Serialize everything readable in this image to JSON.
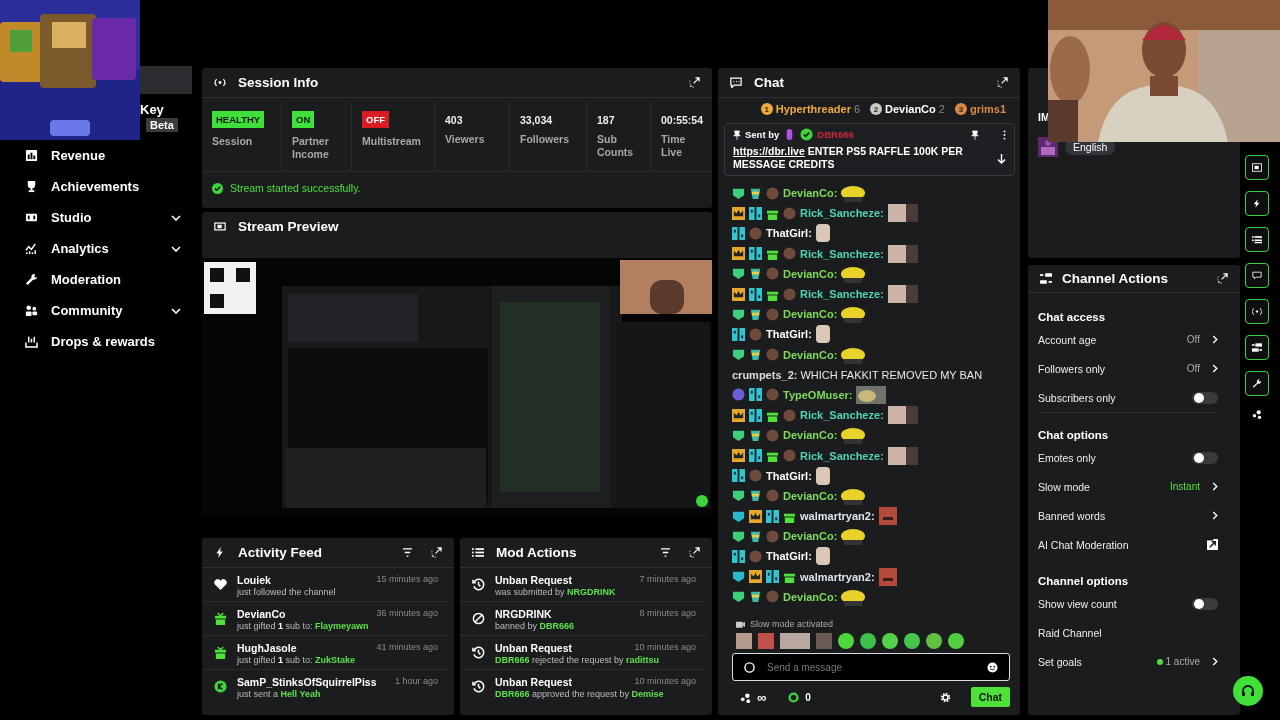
{
  "sidebar": {
    "partial_label": "Key",
    "partial_badge": "Beta",
    "items": [
      {
        "label": "Revenue",
        "submenu": false
      },
      {
        "label": "Achievements",
        "submenu": false
      },
      {
        "label": "Studio",
        "submenu": true
      },
      {
        "label": "Analytics",
        "submenu": true
      },
      {
        "label": "Moderation",
        "submenu": false
      },
      {
        "label": "Community",
        "submenu": true
      },
      {
        "label": "Drops & rewards",
        "submenu": false
      }
    ]
  },
  "session_info": {
    "title": "Session Info",
    "statuses": [
      {
        "badge": "HEALTHY",
        "label": "Session",
        "on": true
      },
      {
        "badge": "ON",
        "label": "Partner Income",
        "on": true
      },
      {
        "badge": "OFF",
        "label": "Multistream",
        "on": false
      }
    ],
    "stats": [
      {
        "value": "403",
        "label": "Viewers"
      },
      {
        "value": "33,034",
        "label": "Followers"
      },
      {
        "value": "187",
        "label": "Sub Counts"
      },
      {
        "value": "00:55:54",
        "label": "Time Live"
      }
    ],
    "notice": "Stream started successfully."
  },
  "stream_preview": {
    "title": "Stream Preview"
  },
  "activity_feed": {
    "title": "Activity Feed",
    "items": [
      {
        "kind": "follow",
        "name": "Louiek",
        "time": "15 minutes ago",
        "detail": [
          {
            "text": "just followed the channel",
            "accent": false
          }
        ]
      },
      {
        "kind": "gift",
        "name": "DevianCo",
        "time": "36 minutes ago",
        "detail": [
          {
            "text": "just gifted **1** sub to: ",
            "accent": false
          },
          {
            "text": "Flaymeyawn",
            "accent": true
          }
        ]
      },
      {
        "kind": "gift",
        "name": "HughJasole",
        "time": "41 minutes ago",
        "detail": [
          {
            "text": "just gifted **1** sub to: ",
            "accent": false
          },
          {
            "text": "ZukStake",
            "accent": true
          }
        ]
      },
      {
        "kind": "coin",
        "name": "SamP_StinksOfSquirrelPiss",
        "time": "1 hour ago",
        "detail": [
          {
            "text": "just sent a ",
            "accent": false
          },
          {
            "text": "Hell Yeah",
            "accent": true
          }
        ]
      }
    ]
  },
  "mod_actions": {
    "title": "Mod Actions",
    "items": [
      {
        "kind": "unban",
        "title": "Unban Request",
        "time": "7 minutes ago",
        "detail": [
          {
            "text": "was submitted by ",
            "accent": false
          },
          {
            "text": "NRGDRINK",
            "accent": true
          }
        ]
      },
      {
        "kind": "ban",
        "title": "NRGDRINK",
        "time": "8 minutes ago",
        "detail": [
          {
            "text": "banned by ",
            "accent": false
          },
          {
            "text": "DBR666",
            "accent": true
          }
        ]
      },
      {
        "kind": "unban",
        "title": "Unban Request",
        "time": "10 minutes ago",
        "detail": [
          {
            "text": "DBR666",
            "accent": true
          },
          {
            "text": " rejected the request by ",
            "accent": false
          },
          {
            "text": "radittsu",
            "accent": true
          }
        ]
      },
      {
        "kind": "unban",
        "title": "Unban Request",
        "time": "10 minutes ago",
        "detail": [
          {
            "text": "DBR666",
            "accent": true
          },
          {
            "text": " approved the request by ",
            "accent": false
          },
          {
            "text": "Demise",
            "accent": true
          }
        ]
      }
    ]
  },
  "chat": {
    "title": "Chat",
    "leaders": [
      {
        "rank": "1",
        "name": "Hyperthreader",
        "count": "6",
        "color": "#f2a93b"
      },
      {
        "rank": "2",
        "name": "DevianCo",
        "count": "2",
        "color": "#c8c8c8"
      },
      {
        "rank": "3",
        "name": "grims1",
        "color": "#d98a4a"
      }
    ],
    "pinned": {
      "label": "Sent by",
      "user": "DBR666",
      "link": "https://dbr.live",
      "text": " ENTER PS5 RAFFLE 100K PER MESSAGE CREDITS"
    },
    "messages": [
      {
        "kind": "regular",
        "user": "DevianCo:",
        "color": "#7edb5a"
      },
      {
        "kind": "crowned",
        "user": "Rick_Sancheze:",
        "color": "#4fd4b4"
      },
      {
        "kind": "plain",
        "user": "ThatGirl:",
        "color": "#ffffff"
      },
      {
        "kind": "crowned",
        "user": "Rick_Sancheze:",
        "color": "#4fd4b4"
      },
      {
        "kind": "regular",
        "user": "DevianCo:",
        "color": "#7edb5a"
      },
      {
        "kind": "crowned",
        "user": "Rick_Sancheze:",
        "color": "#4fd4b4"
      },
      {
        "kind": "regular",
        "user": "DevianCo:",
        "color": "#7edb5a"
      },
      {
        "kind": "plain",
        "user": "ThatGirl:",
        "color": "#ffffff"
      },
      {
        "kind": "regular",
        "user": "DevianCo:",
        "color": "#7edb5a"
      },
      {
        "kind": "text",
        "user": "crumpets_2:",
        "color": "#dcdcdc",
        "text": "WHICH FAKKIT REMOVED MY BAN"
      },
      {
        "kind": "sub",
        "user": "TypeOMuser:",
        "color": "#7edb5a"
      },
      {
        "kind": "crowned",
        "user": "Rick_Sancheze:",
        "color": "#4fd4b4"
      },
      {
        "kind": "regular",
        "user": "DevianCo:",
        "color": "#7edb5a"
      },
      {
        "kind": "crowned",
        "user": "Rick_Sancheze:",
        "color": "#4fd4b4"
      },
      {
        "kind": "plain",
        "user": "ThatGirl:",
        "color": "#ffffff"
      },
      {
        "kind": "regular",
        "user": "DevianCo:",
        "color": "#7edb5a"
      },
      {
        "kind": "tiered",
        "user": "walmartryan2:",
        "color": "#dfe6ea"
      },
      {
        "kind": "regular",
        "user": "DevianCo:",
        "color": "#7edb5a"
      },
      {
        "kind": "plain",
        "user": "ThatGirl:",
        "color": "#ffffff"
      },
      {
        "kind": "tiered",
        "user": "walmartryan2:",
        "color": "#dfe6ea"
      },
      {
        "kind": "regular",
        "user": "DevianCo:",
        "color": "#7edb5a"
      }
    ],
    "notice": "Slow mode activated",
    "input": {
      "placeholder": "Send a message"
    },
    "footer": {
      "points": "∞",
      "count": "0"
    },
    "send_button": "Chat"
  },
  "side_panel": {
    "cut_text": "IM",
    "language": "English"
  },
  "channel_actions": {
    "title": "Channel Actions",
    "rows": [
      {
        "kind": "section",
        "label": "Chat access"
      },
      {
        "kind": "value",
        "label": "Account age",
        "value": "Off",
        "accent": false
      },
      {
        "kind": "value",
        "label": "Followers only",
        "value": "Off",
        "accent": false
      },
      {
        "kind": "toggle",
        "label": "Subscribers only",
        "on": false
      },
      {
        "kind": "section",
        "label": "Chat options"
      },
      {
        "kind": "toggle",
        "label": "Emotes only",
        "on": false
      },
      {
        "kind": "value",
        "label": "Slow mode",
        "value": "Instant",
        "accent": true
      },
      {
        "kind": "value",
        "label": "Banned words"
      },
      {
        "kind": "external",
        "label": "AI Chat Moderation"
      },
      {
        "kind": "section",
        "label": "Channel options"
      },
      {
        "kind": "toggle",
        "label": "Show view count",
        "on": false
      },
      {
        "kind": "plain",
        "label": "Raid Channel"
      },
      {
        "kind": "goal",
        "label": "Set goals",
        "value": "1 active"
      }
    ]
  }
}
